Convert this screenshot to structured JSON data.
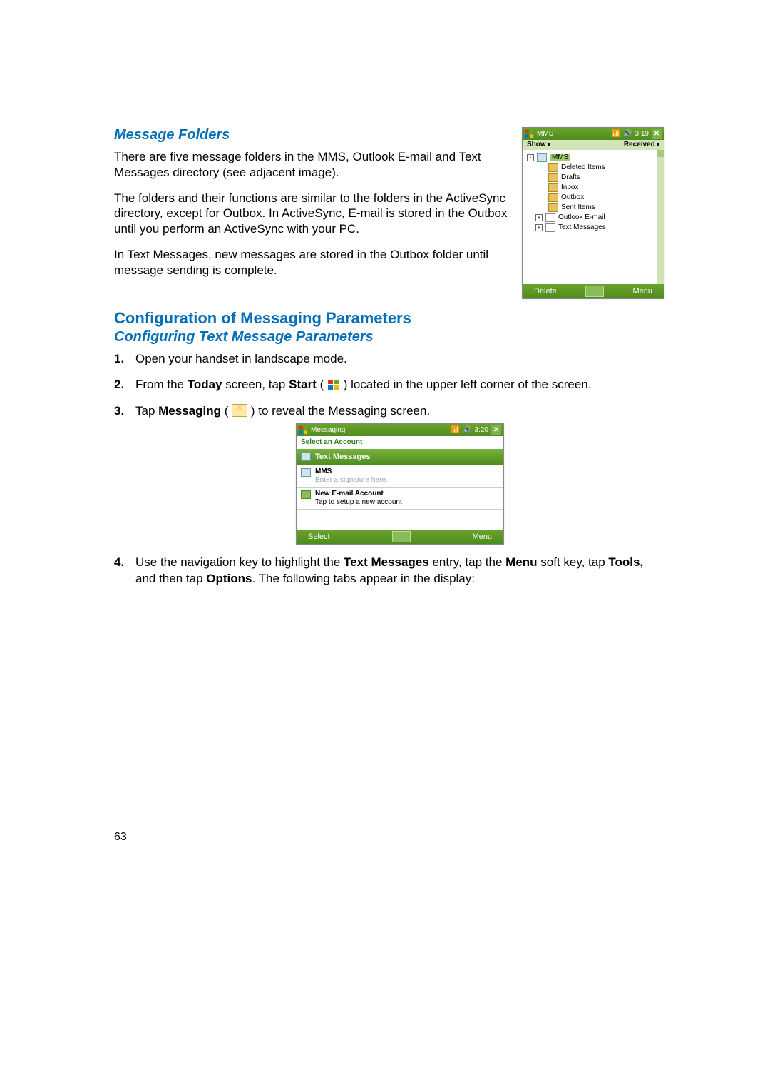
{
  "headings": {
    "message_folders": "Message Folders",
    "config_params": "Configuration of Messaging Parameters",
    "config_text": "Configuring Text Message Parameters"
  },
  "paragraphs": {
    "p1": "There are five message folders in the MMS, Outlook E-mail and Text Messages directory (see adjacent image).",
    "p2": "The folders and their functions are similar to the folders in the ActiveSync directory, except for Outbox. In ActiveSync, E-mail is stored in the Outbox until you perform an ActiveSync with your PC.",
    "p3": "In Text Messages, new messages are stored in the Outbox folder until message sending is complete."
  },
  "steps": {
    "s1": "Open your handset in landscape mode.",
    "s2a": "From the ",
    "s2_today": "Today",
    "s2b": " screen, tap ",
    "s2_start": "Start",
    "s2c": " ( ",
    "s2d": " ) located in the upper left corner of the screen.",
    "s3a": "Tap ",
    "s3_msg": "Messaging",
    "s3b": " ( ",
    "s3c": " ) to reveal the Messaging screen.",
    "s4a": "Use the navigation key to highlight the ",
    "s4_tm": "Text Messages",
    "s4b": " entry, tap the ",
    "s4_menu": "Menu",
    "s4c": " soft key, tap ",
    "s4_tools": "Tools,",
    "s4d": " and then tap ",
    "s4_opts": "Options",
    "s4e": ". The following tabs appear in the display:"
  },
  "shot1": {
    "title": "MMS",
    "time": "3:19",
    "show": "Show",
    "received": "Received",
    "tree": {
      "mms": "MMS",
      "items": [
        "Deleted Items",
        "Drafts",
        "Inbox",
        "Outbox",
        "Sent Items"
      ],
      "outlook": "Outlook E-mail",
      "textmsg": "Text Messages"
    },
    "soft_left": "Delete",
    "soft_right": "Menu"
  },
  "shot2": {
    "title": "Messaging",
    "time": "3:20",
    "select": "Select an Account",
    "text_messages": "Text Messages",
    "mms": "MMS",
    "sig": "Enter a signature here.",
    "new_acct": "New E-mail Account",
    "new_acct_sub": "Tap to setup a new account",
    "soft_left": "Select",
    "soft_right": "Menu"
  },
  "page_number": "63"
}
